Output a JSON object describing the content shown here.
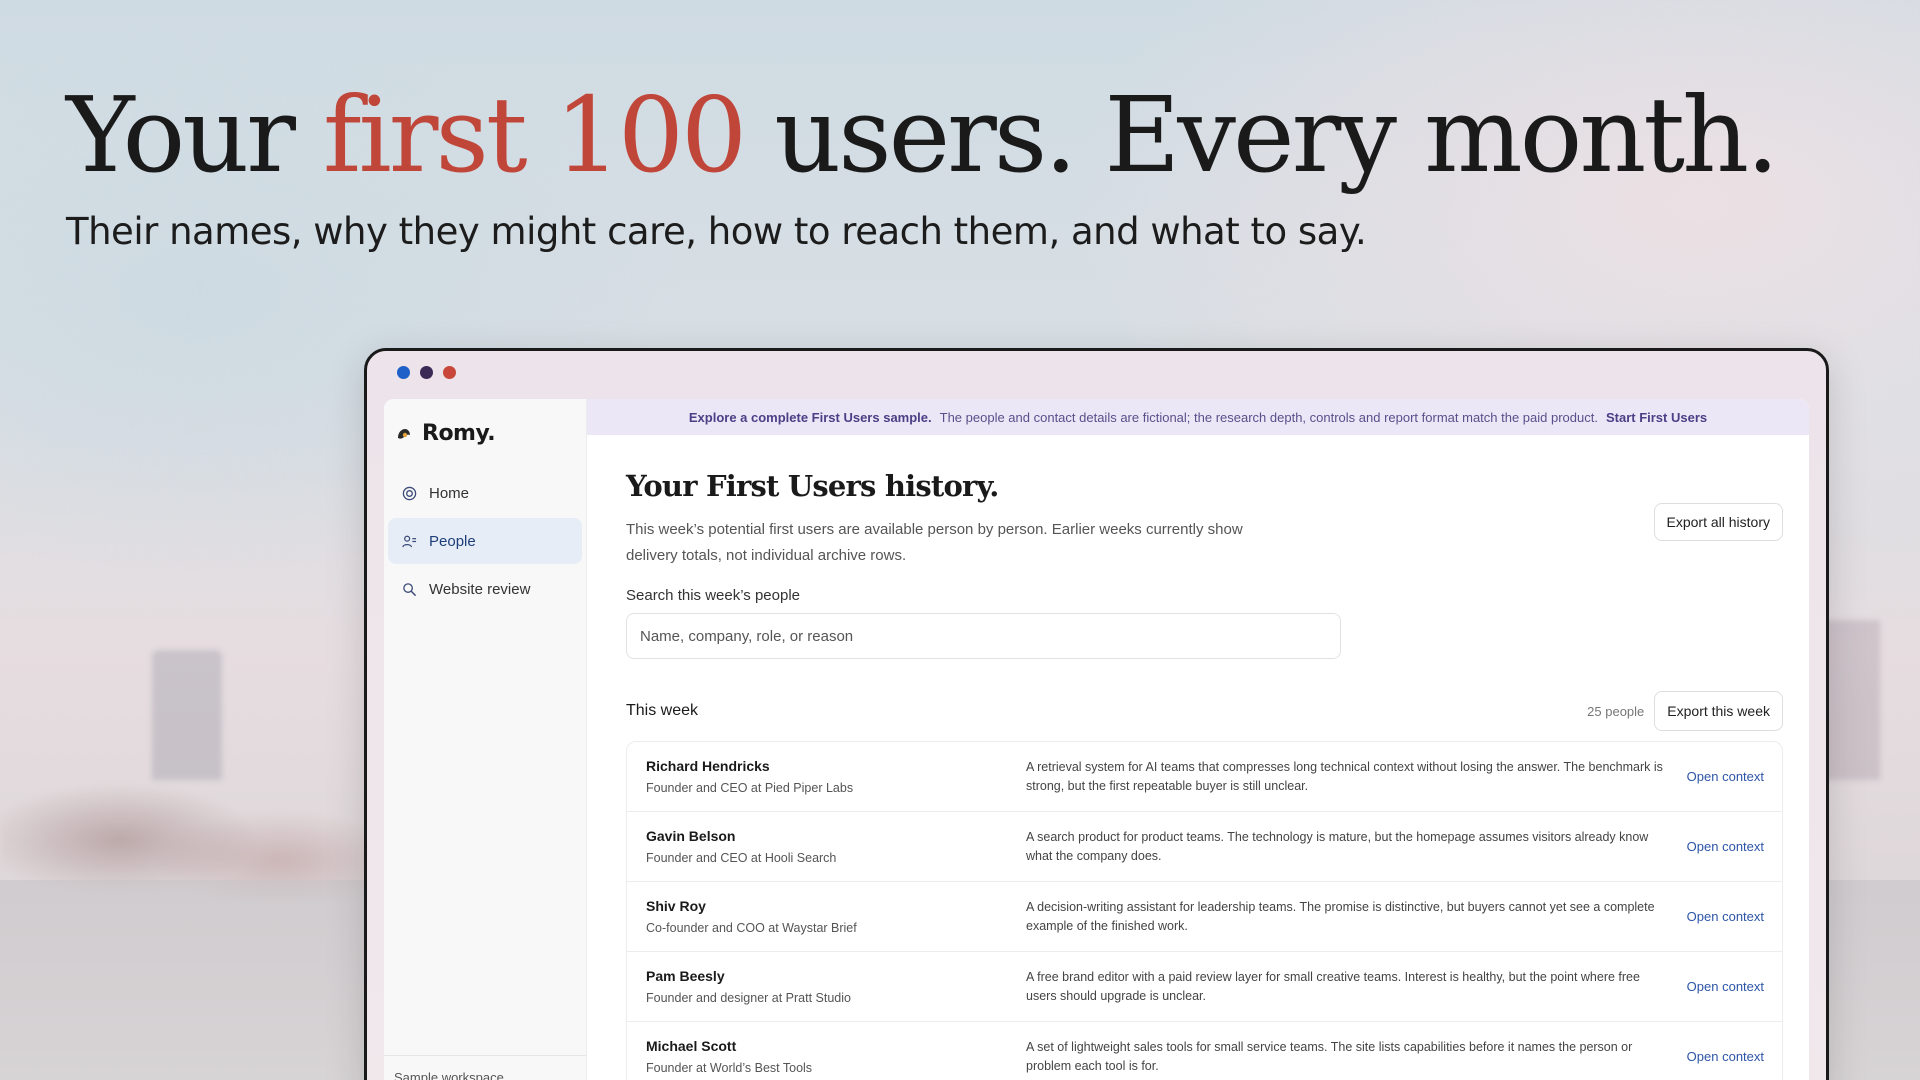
{
  "hero": {
    "title_before": "Your ",
    "title_accent": "first 100",
    "title_after": " users. Every month.",
    "subtitle": "Their names, why they might care, how to reach them, and what to say."
  },
  "colors": {
    "accent": "#c0463a",
    "link": "#2c55a8",
    "banner_bg": "#ece7f7",
    "active_nav_bg": "#e6edf6"
  },
  "window": {
    "traffic_lights": [
      "blue",
      "navy",
      "red"
    ]
  },
  "sidebar": {
    "brand": "Romy.",
    "brand_icon": "romy-logo-icon",
    "items": [
      {
        "label": "Home",
        "icon": "target-icon",
        "active": false
      },
      {
        "label": "People",
        "icon": "people-icon",
        "active": true
      },
      {
        "label": "Website review",
        "icon": "search-icon",
        "active": false
      }
    ],
    "workspace": "Sample workspace"
  },
  "banner": {
    "lead": "Explore a complete First Users sample.",
    "text": "The people and contact details are fictional; the research depth, controls and report format match the paid product.",
    "cta": "Start First Users"
  },
  "main": {
    "title": "Your First Users history.",
    "export_all": "Export all history",
    "description": "This week’s potential first users are available person by person. Earlier weeks currently show delivery totals, not individual archive rows.",
    "search_label": "Search this week’s people",
    "search_placeholder": "Name, company, role, or reason",
    "week_title": "This week",
    "people_count": "25 people",
    "export_week": "Export this week",
    "open_label": "Open context",
    "rows": [
      {
        "name": "Richard Hendricks",
        "role": "Founder and CEO at Pied Piper Labs",
        "reason": "A retrieval system for AI teams that compresses long technical context without losing the answer. The benchmark is strong, but the first repeatable buyer is still unclear."
      },
      {
        "name": "Gavin Belson",
        "role": "Founder and CEO at Hooli Search",
        "reason": "A search product for product teams. The technology is mature, but the homepage assumes visitors already know what the company does."
      },
      {
        "name": "Shiv Roy",
        "role": "Co-founder and COO at Waystar Brief",
        "reason": "A decision-writing assistant for leadership teams. The promise is distinctive, but buyers cannot yet see a complete example of the finished work."
      },
      {
        "name": "Pam Beesly",
        "role": "Founder and designer at Pratt Studio",
        "reason": "A free brand editor with a paid review layer for small creative teams. Interest is healthy, but the point where free users should upgrade is unclear."
      },
      {
        "name": "Michael Scott",
        "role": "Founder at World’s Best Tools",
        "reason": "A set of lightweight sales tools for small service teams. The site lists capabilities before it names the person or problem each tool is for."
      }
    ]
  }
}
